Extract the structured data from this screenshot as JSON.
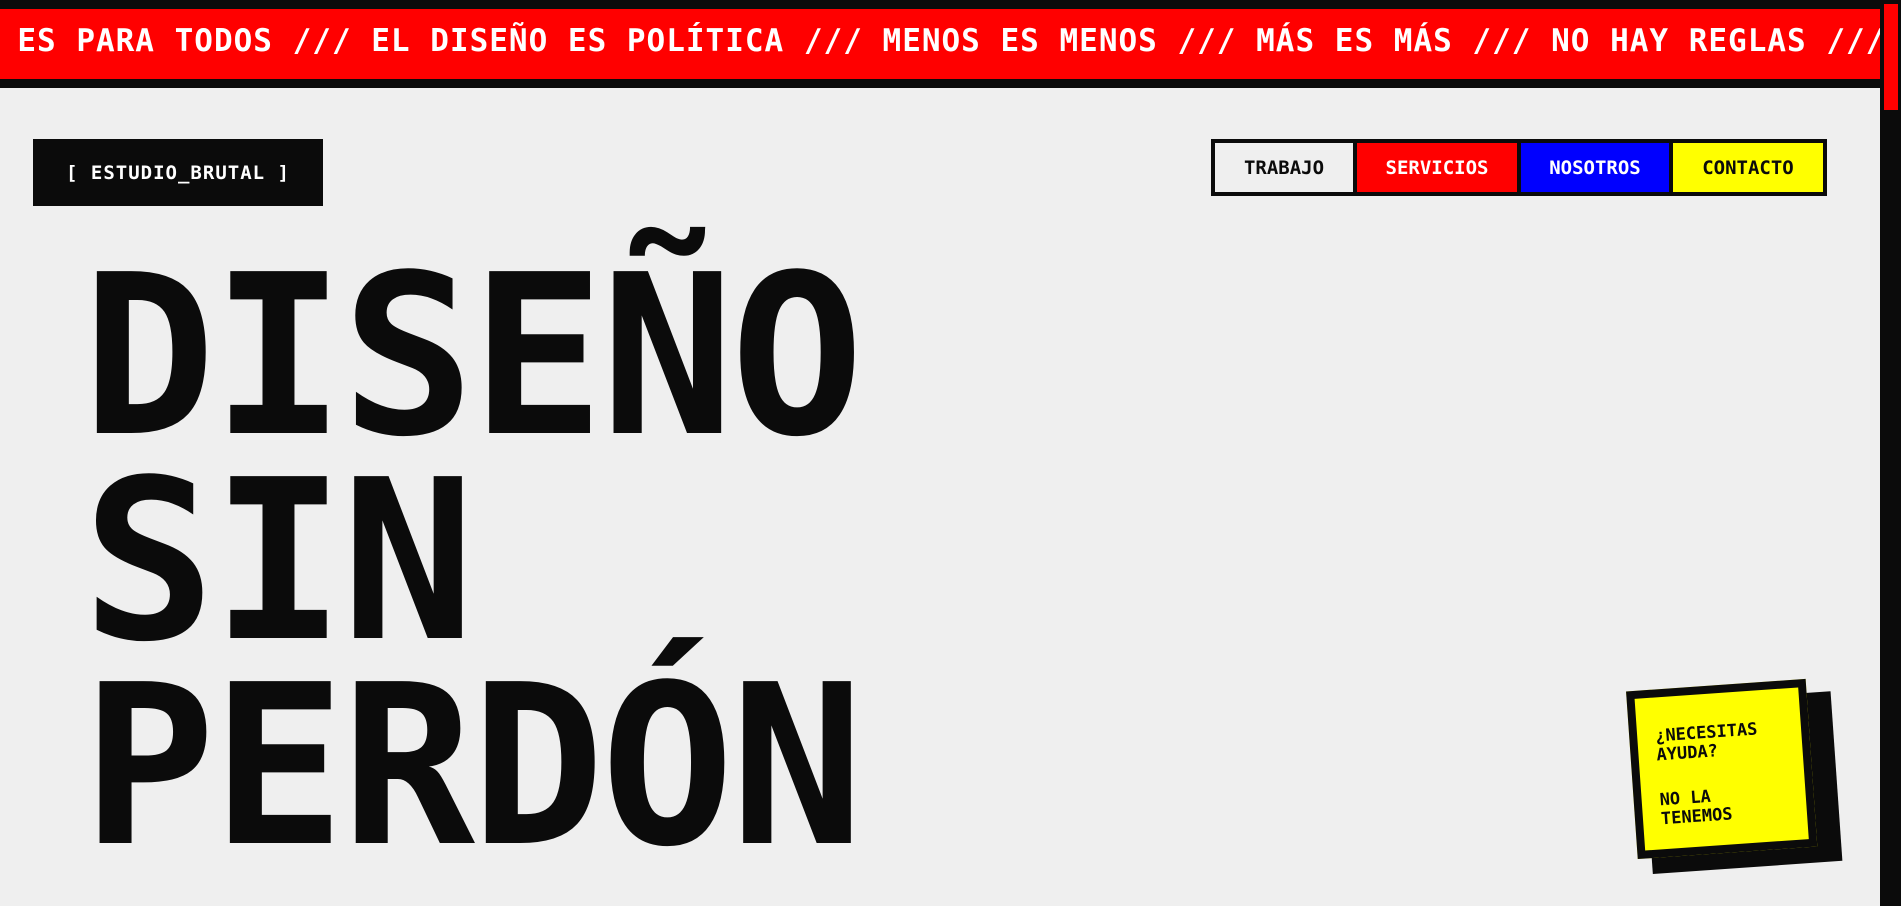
{
  "ticker": {
    "text": "O ES PARA TODOS /// EL DISEÑO ES POLÍTICA /// MENOS ES MENOS /// MÁS ES MÁS /// NO HAY REGLAS /// ROMPE"
  },
  "logo": {
    "label": "[ ESTUDIO_BRUTAL ]"
  },
  "nav": {
    "items": [
      {
        "label": "TRABAJO"
      },
      {
        "label": "SERVICIOS"
      },
      {
        "label": "NOSOTROS"
      },
      {
        "label": "CONTACTO"
      }
    ]
  },
  "hero": {
    "lines": [
      "DISEÑO",
      "SIN",
      "PERDÓN"
    ]
  },
  "sticker": {
    "question": "¿NECESITAS AYUDA?",
    "answer": "NO LA TENEMOS"
  },
  "colors": {
    "red": "#ff0000",
    "blue": "#0000ff",
    "yellow": "#ffff00",
    "black": "#0b0b0b",
    "background": "#efefef"
  }
}
